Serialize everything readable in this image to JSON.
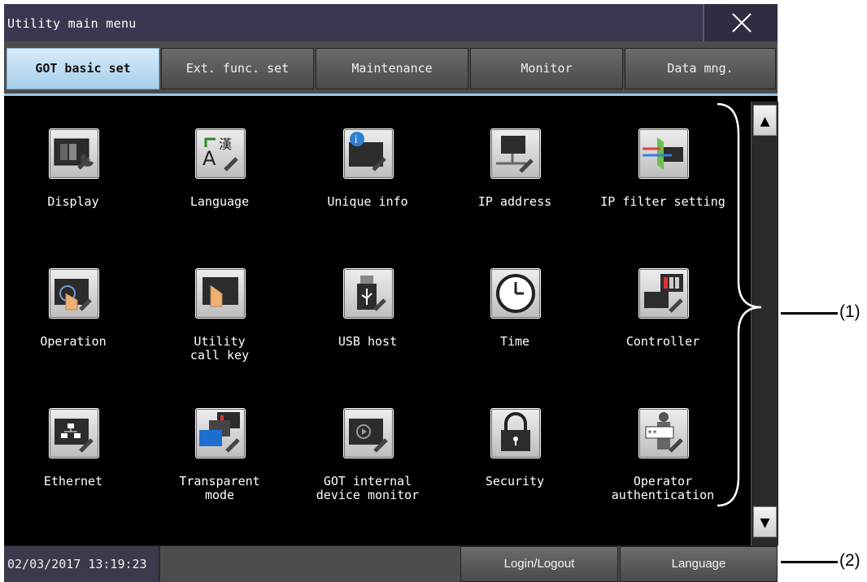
{
  "window": {
    "title": "Utility main menu",
    "close_icon": "close-icon"
  },
  "tabs": [
    {
      "label": "GOT basic set",
      "active": true
    },
    {
      "label": "Ext. func. set",
      "active": false
    },
    {
      "label": "Maintenance",
      "active": false
    },
    {
      "label": "Monitor",
      "active": false
    },
    {
      "label": "Data mng.",
      "active": false
    }
  ],
  "items": [
    {
      "label": "Display",
      "icon": "display-icon"
    },
    {
      "label": "Language",
      "icon": "language-icon"
    },
    {
      "label": "Unique info",
      "icon": "unique-info-icon"
    },
    {
      "label": "IP address",
      "icon": "ip-address-icon"
    },
    {
      "label": "IP filter setting",
      "icon": "ip-filter-icon"
    },
    {
      "label": "Operation",
      "icon": "operation-icon"
    },
    {
      "label": "Utility\ncall key",
      "icon": "utility-call-key-icon"
    },
    {
      "label": "USB host",
      "icon": "usb-host-icon"
    },
    {
      "label": "Time",
      "icon": "clock-icon"
    },
    {
      "label": "Controller",
      "icon": "controller-icon"
    },
    {
      "label": "Ethernet",
      "icon": "ethernet-icon"
    },
    {
      "label": "Transparent\nmode",
      "icon": "transparent-mode-icon"
    },
    {
      "label": "GOT internal\ndevice monitor",
      "icon": "device-monitor-icon"
    },
    {
      "label": "Security",
      "icon": "padlock-icon"
    },
    {
      "label": "Operator\nauthentication",
      "icon": "operator-auth-icon"
    }
  ],
  "scrollbar": {
    "up_icon": "scroll-up-arrow-icon",
    "down_icon": "scroll-down-arrow-icon"
  },
  "statusbar": {
    "datetime": "02/03/2017 13:19:23",
    "login_label": "Login/Logout",
    "language_label": "Language"
  },
  "callouts": {
    "one": "(1)",
    "two": "(2)"
  },
  "colors": {
    "accent_tab": "#a6cdea",
    "titlebar": "#3a3750",
    "background": "#000000"
  }
}
